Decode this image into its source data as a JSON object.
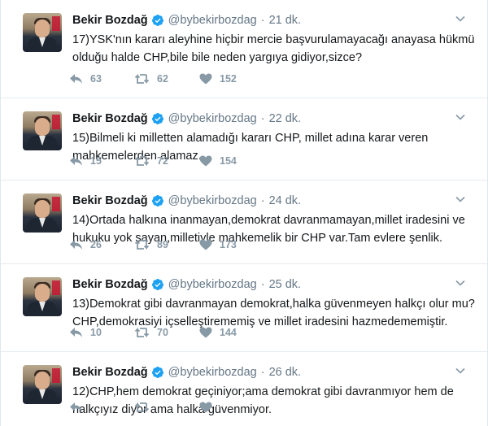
{
  "tweets": [
    {
      "name": "Bekir Bozdağ",
      "handle": "@bybekirbozdag",
      "time": "21 dk.",
      "text": "17)YSK'nın kararı aleyhine hiçbir mercie başvurulamayacağı anayasa hükmü olduğu halde CHP,bile bile neden yargıya gidiyor,sizce?",
      "replies": "63",
      "retweets": "62",
      "likes": "152"
    },
    {
      "name": "Bekir Bozdağ",
      "handle": "@bybekirbozdag",
      "time": "22 dk.",
      "text": "15)Bilmeli ki milletten alamadığı kararı CHP, millet adına karar veren mahkemelerden alamaz.",
      "replies": "15",
      "retweets": "72",
      "likes": "154"
    },
    {
      "name": "Bekir Bozdağ",
      "handle": "@bybekirbozdag",
      "time": "24 dk.",
      "text": "14)Ortada halkına inanmayan,demokrat davranmamayan,millet iradesini ve hukuku yok sayan,milletiyle mahkemelik bir CHP var.Tam evlere şenlik.",
      "replies": "26",
      "retweets": "89",
      "likes": "173"
    },
    {
      "name": "Bekir Bozdağ",
      "handle": "@bybekirbozdag",
      "time": "25 dk.",
      "text": "13)Demokrat gibi davranmayan demokrat,halka güvenmeyen halkçı olur mu? CHP,demokrasiyi içselleştirememiş ve millet iradesini hazmedememiştir.",
      "replies": "10",
      "retweets": "70",
      "likes": "144"
    },
    {
      "name": "Bekir Bozdağ",
      "handle": "@bybekirbozdag",
      "time": "26 dk.",
      "text": "12)CHP,hem demokrat geçiniyor;ama demokrat gibi davranmıyor hem de halkçıyız diyor ama halka güvenmiyor.",
      "replies": "",
      "retweets": "",
      "likes": ""
    }
  ],
  "icons": {
    "verified": "verified-badge-icon",
    "caret": "chevron-down-icon",
    "reply": "reply-icon",
    "retweet": "retweet-icon",
    "like": "heart-icon"
  },
  "colors": {
    "verified_blue": "#1da1f2",
    "muted_gray": "#657786",
    "action_gray": "#8899a6",
    "divider": "#e6ecf0"
  }
}
